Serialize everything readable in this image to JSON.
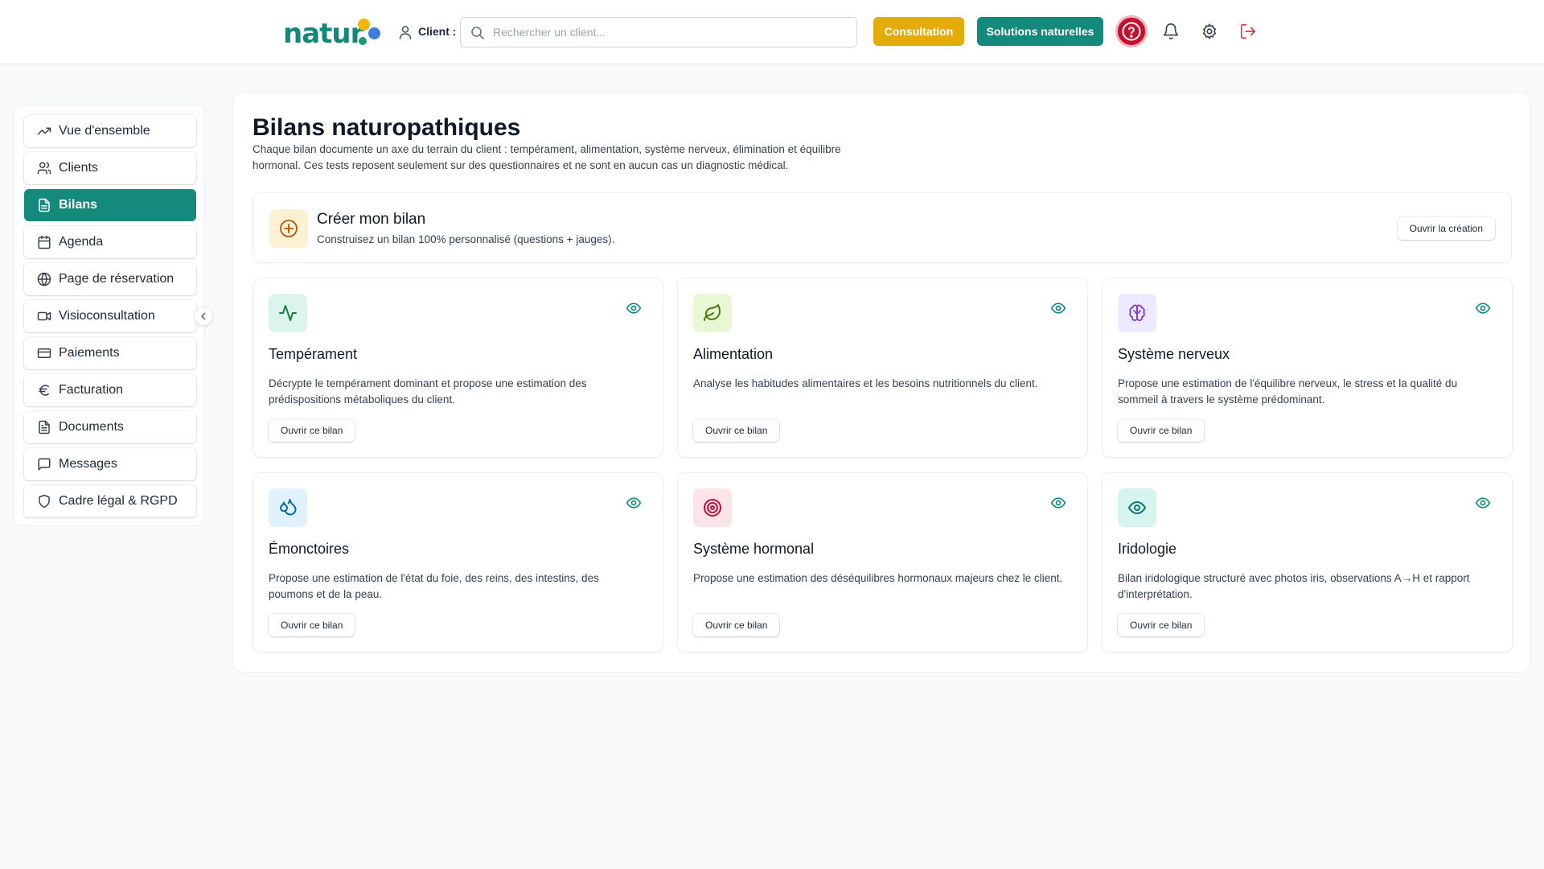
{
  "header": {
    "logo_text": "natur",
    "client_label": "Client :",
    "search_placeholder": "Rechercher un client...",
    "consultation_label": "Consultation",
    "solutions_label": "Solutions naturelles"
  },
  "colors": {
    "brand": "#148a7c",
    "accent": "#e3ac0a",
    "help": "#c8102e",
    "logout": "#d9363e"
  },
  "sidebar": {
    "items": [
      {
        "label": "Vue d'ensemble",
        "icon": "trending-up-icon",
        "active": false
      },
      {
        "label": "Clients",
        "icon": "users-icon",
        "active": false
      },
      {
        "label": "Bilans",
        "icon": "file-text-icon",
        "active": true
      },
      {
        "label": "Agenda",
        "icon": "calendar-icon",
        "active": false
      },
      {
        "label": "Page de réservation",
        "icon": "globe-icon",
        "active": false
      },
      {
        "label": "Visioconsultation",
        "icon": "video-icon",
        "active": false
      },
      {
        "label": "Paiements",
        "icon": "credit-card-icon",
        "active": false
      },
      {
        "label": "Facturation",
        "icon": "euro-icon",
        "active": false
      },
      {
        "label": "Documents",
        "icon": "document-icon",
        "active": false
      },
      {
        "label": "Messages",
        "icon": "message-icon",
        "active": false
      },
      {
        "label": "Cadre légal & RGPD",
        "icon": "shield-icon",
        "active": false
      }
    ]
  },
  "main": {
    "title": "Bilans naturopathiques",
    "description": "Chaque bilan documente un axe du terrain du client : tempérament, alimentation, système nerveux, élimination et équilibre hormonal. Ces tests reposent seulement sur des questionnaires et ne sont en aucun cas un diagnostic médical.",
    "create": {
      "title": "Créer mon bilan",
      "description": "Construisez un bilan 100% personnalisé (questions + jauges).",
      "button": "Ouvrir la création"
    },
    "cards": [
      {
        "title": "Tempérament",
        "description": "Décrypte le tempérament dominant et propose une estimation des prédispositions métaboliques du client.",
        "button": "Ouvrir ce bilan",
        "icon": "activity-icon"
      },
      {
        "title": "Alimentation",
        "description": "Analyse les habitudes alimentaires et les besoins nutritionnels du client.",
        "button": "Ouvrir ce bilan",
        "icon": "leaf-icon"
      },
      {
        "title": "Système nerveux",
        "description": "Propose une estimation de l'équilibre nerveux, le stress et la qualité du sommeil à travers le système prédominant.",
        "button": "Ouvrir ce bilan",
        "icon": "brain-icon"
      },
      {
        "title": "Émonctoires",
        "description": "Propose une estimation de l'état du foie, des reins, des intestins, des poumons et de la peau.",
        "button": "Ouvrir ce bilan",
        "icon": "droplets-icon"
      },
      {
        "title": "Système hormonal",
        "description": "Propose une estimation des déséquilibres hormonaux majeurs chez le client.",
        "button": "Ouvrir ce bilan",
        "icon": "target-icon"
      },
      {
        "title": "Iridologie",
        "description": "Bilan iridologique structuré avec photos iris, observations A→H et rapport d'interprétation.",
        "button": "Ouvrir ce bilan",
        "icon": "eye-icon"
      }
    ]
  }
}
